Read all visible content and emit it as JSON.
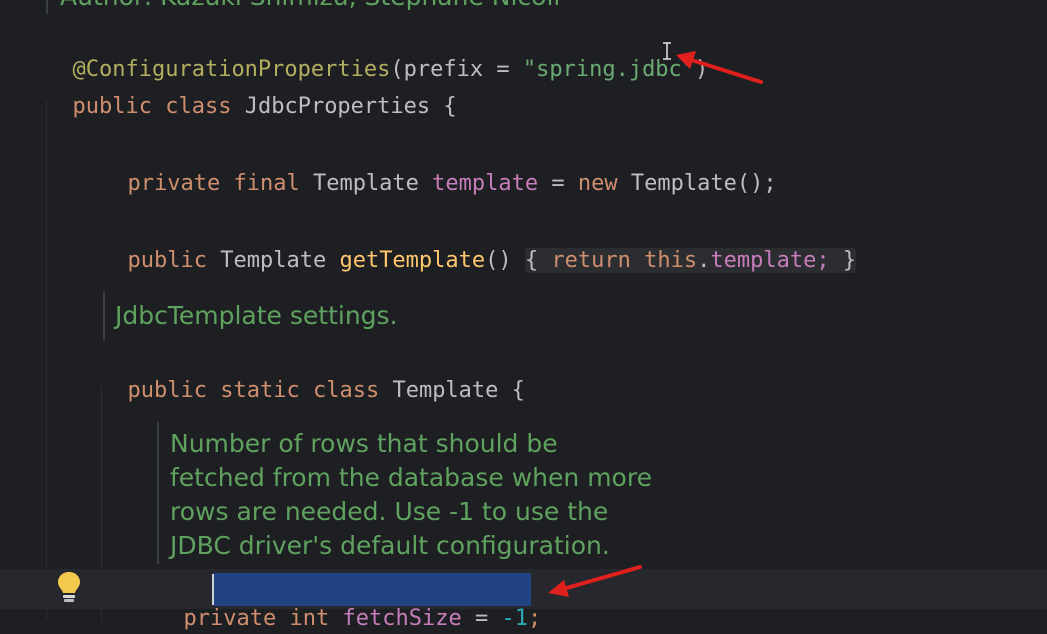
{
  "editor": {
    "author_line": "Author: Kazuki Shimizu, Stephane Nicoll",
    "annotation_name": "@ConfigurationProperties",
    "annotation_open": "(",
    "annotation_param": "prefix = ",
    "annotation_value": "\"spring.jdbc\"",
    "annotation_close": ")",
    "class_decl": {
      "kw1": "public",
      "kw2": "class",
      "name": "JdbcProperties",
      "brace": "{"
    },
    "field_decl": {
      "kw1": "private",
      "kw2": "final",
      "type": "Template",
      "name": "template",
      "eq": "=",
      "kw_new": "new",
      "init": "Template();"
    },
    "getter": {
      "kw": "public",
      "type": "Template",
      "name": "getTemplate",
      "parens": "()",
      "open": "{",
      "kw_return": "return",
      "kw_this": "this",
      "dot": ".",
      "field": "template;",
      "close": "}"
    },
    "doc1": "JdbcTemplate settings.",
    "inner_class": {
      "kw1": "public",
      "kw2": "static",
      "kw3": "class",
      "name": "Template",
      "brace": "{"
    },
    "doc2_lines": [
      "Number of rows that should be",
      "fetched from the database when more",
      "rows are needed. Use -1 to use the",
      "JDBC driver's default configuration."
    ],
    "fetch_field": {
      "kw_part1": "priv",
      "kw_part2": "ate",
      "type": "int",
      "name": "fetchSize",
      "eq": "=",
      "value": "-1",
      "semi": ";"
    }
  },
  "colors": {
    "background": "#1e1f22",
    "keyword": "#cf8e6d",
    "annotation": "#b3ae60",
    "string": "#6aab73",
    "field": "#c77dbb",
    "method": "#ffc66d",
    "number": "#2aacb8",
    "doc": "#5fa25f",
    "selection": "#214283",
    "arrow": "#e0201c"
  },
  "icons": {
    "intention": "lightbulb-icon",
    "pointer": "text-cursor-icon"
  }
}
